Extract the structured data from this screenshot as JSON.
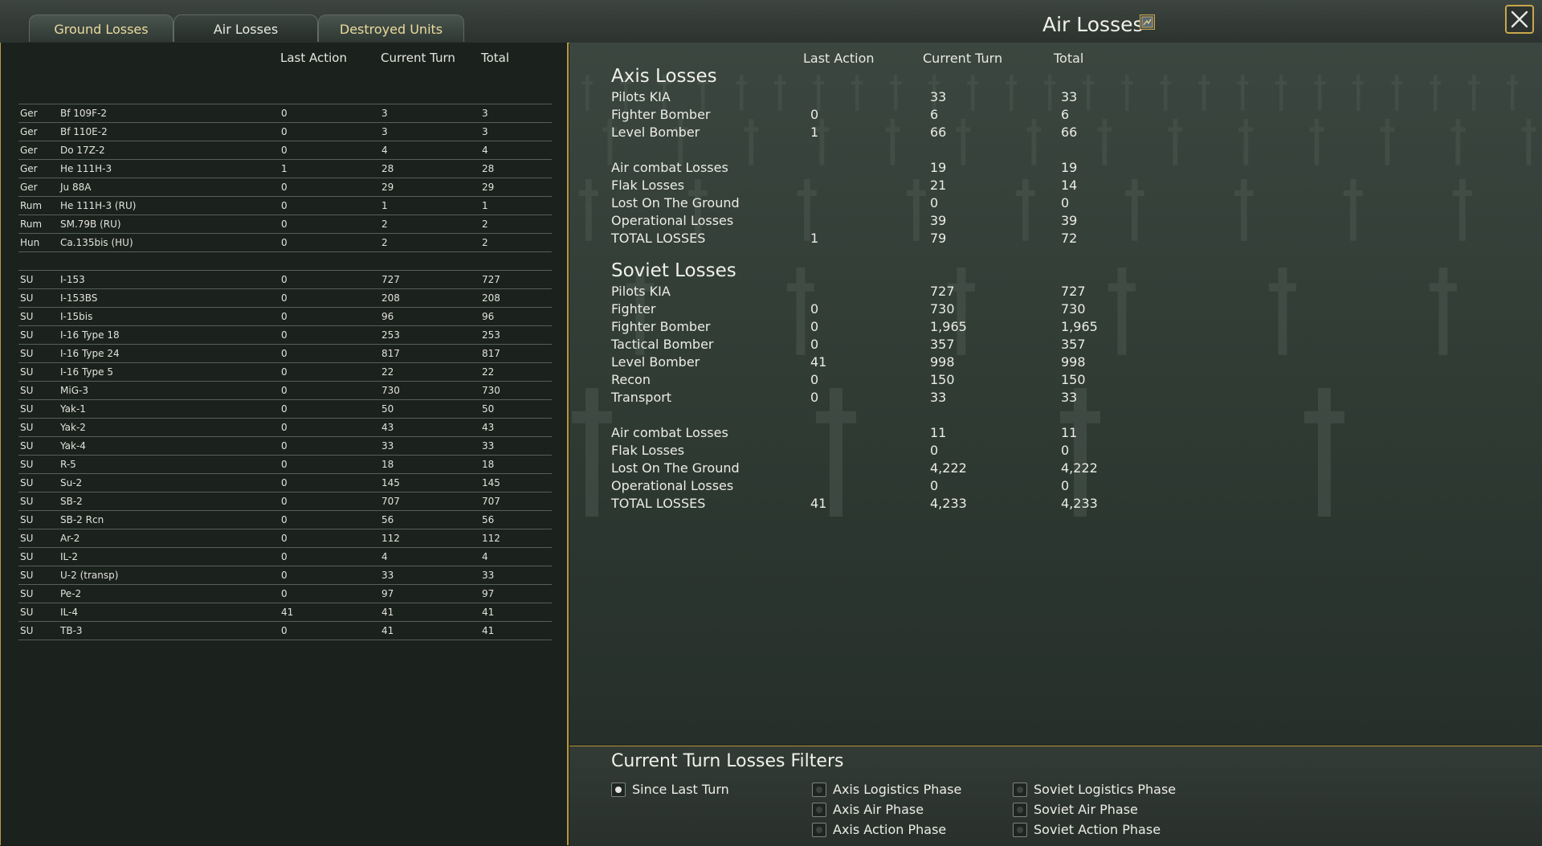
{
  "tabs": {
    "ground": "Ground Losses",
    "air": "Air Losses",
    "destroyed": "Destroyed Units"
  },
  "panel_title": "Air Losses",
  "left": {
    "headers": {
      "last_action": "Last Action",
      "current_turn": "Current Turn",
      "total": "Total"
    },
    "axis_rows": [
      {
        "nat": "Ger",
        "name": "Bf 109F-2",
        "la": "0",
        "ct": "3",
        "tot": "3"
      },
      {
        "nat": "Ger",
        "name": "Bf 110E-2",
        "la": "0",
        "ct": "3",
        "tot": "3"
      },
      {
        "nat": "Ger",
        "name": "Do 17Z-2",
        "la": "0",
        "ct": "4",
        "tot": "4"
      },
      {
        "nat": "Ger",
        "name": "He 111H-3",
        "la": "1",
        "ct": "28",
        "tot": "28"
      },
      {
        "nat": "Ger",
        "name": "Ju 88A",
        "la": "0",
        "ct": "29",
        "tot": "29"
      },
      {
        "nat": "Rum",
        "name": "He 111H-3 (RU)",
        "la": "0",
        "ct": "1",
        "tot": "1"
      },
      {
        "nat": "Rum",
        "name": "SM.79B (RU)",
        "la": "0",
        "ct": "2",
        "tot": "2"
      },
      {
        "nat": "Hun",
        "name": "Ca.135bis (HU)",
        "la": "0",
        "ct": "2",
        "tot": "2"
      }
    ],
    "soviet_rows": [
      {
        "nat": "SU",
        "name": "I-153",
        "la": "0",
        "ct": "727",
        "tot": "727"
      },
      {
        "nat": "SU",
        "name": "I-153BS",
        "la": "0",
        "ct": "208",
        "tot": "208"
      },
      {
        "nat": "SU",
        "name": "I-15bis",
        "la": "0",
        "ct": "96",
        "tot": "96"
      },
      {
        "nat": "SU",
        "name": "I-16 Type 18",
        "la": "0",
        "ct": "253",
        "tot": "253"
      },
      {
        "nat": "SU",
        "name": "I-16 Type 24",
        "la": "0",
        "ct": "817",
        "tot": "817"
      },
      {
        "nat": "SU",
        "name": "I-16 Type 5",
        "la": "0",
        "ct": "22",
        "tot": "22"
      },
      {
        "nat": "SU",
        "name": "MiG-3",
        "la": "0",
        "ct": "730",
        "tot": "730"
      },
      {
        "nat": "SU",
        "name": "Yak-1",
        "la": "0",
        "ct": "50",
        "tot": "50"
      },
      {
        "nat": "SU",
        "name": "Yak-2",
        "la": "0",
        "ct": "43",
        "tot": "43"
      },
      {
        "nat": "SU",
        "name": "Yak-4",
        "la": "0",
        "ct": "33",
        "tot": "33"
      },
      {
        "nat": "SU",
        "name": "R-5",
        "la": "0",
        "ct": "18",
        "tot": "18"
      },
      {
        "nat": "SU",
        "name": "Su-2",
        "la": "0",
        "ct": "145",
        "tot": "145"
      },
      {
        "nat": "SU",
        "name": "SB-2",
        "la": "0",
        "ct": "707",
        "tot": "707"
      },
      {
        "nat": "SU",
        "name": "SB-2 Rcn",
        "la": "0",
        "ct": "56",
        "tot": "56"
      },
      {
        "nat": "SU",
        "name": "Ar-2",
        "la": "0",
        "ct": "112",
        "tot": "112"
      },
      {
        "nat": "SU",
        "name": "IL-2",
        "la": "0",
        "ct": "4",
        "tot": "4"
      },
      {
        "nat": "SU",
        "name": "U-2 (transp)",
        "la": "0",
        "ct": "33",
        "tot": "33"
      },
      {
        "nat": "SU",
        "name": "Pe-2",
        "la": "0",
        "ct": "97",
        "tot": "97"
      },
      {
        "nat": "SU",
        "name": "IL-4",
        "la": "41",
        "ct": "41",
        "tot": "41"
      },
      {
        "nat": "SU",
        "name": "TB-3",
        "la": "0",
        "ct": "41",
        "tot": "41"
      }
    ]
  },
  "right": {
    "headers": {
      "last_action": "Last Action",
      "current_turn": "Current Turn",
      "total": "Total"
    },
    "axis_title": "Axis Losses",
    "axis_rows": [
      {
        "label": "Pilots KIA",
        "la": "",
        "ct": "33",
        "tot": "33"
      },
      {
        "label": "Fighter Bomber",
        "la": "0",
        "ct": "6",
        "tot": "6"
      },
      {
        "label": "Level Bomber",
        "la": "1",
        "ct": "66",
        "tot": "66"
      },
      {
        "label": "",
        "la": "",
        "ct": "",
        "tot": ""
      },
      {
        "label": "Air combat Losses",
        "la": "",
        "ct": "19",
        "tot": "19"
      },
      {
        "label": "Flak Losses",
        "la": "",
        "ct": "21",
        "tot": "14"
      },
      {
        "label": "Lost On The Ground",
        "la": "",
        "ct": "0",
        "tot": "0"
      },
      {
        "label": "Operational Losses",
        "la": "",
        "ct": "39",
        "tot": "39"
      },
      {
        "label": "TOTAL LOSSES",
        "la": "1",
        "ct": "79",
        "tot": "72"
      }
    ],
    "soviet_title": "Soviet Losses",
    "soviet_rows": [
      {
        "label": "Pilots KIA",
        "la": "",
        "ct": "727",
        "tot": "727"
      },
      {
        "label": "Fighter",
        "la": "0",
        "ct": "730",
        "tot": "730"
      },
      {
        "label": "Fighter Bomber",
        "la": "0",
        "ct": "1,965",
        "tot": "1,965"
      },
      {
        "label": "Tactical Bomber",
        "la": "0",
        "ct": "357",
        "tot": "357"
      },
      {
        "label": "Level Bomber",
        "la": "41",
        "ct": "998",
        "tot": "998"
      },
      {
        "label": "Recon",
        "la": "0",
        "ct": "150",
        "tot": "150"
      },
      {
        "label": "Transport",
        "la": "0",
        "ct": "33",
        "tot": "33"
      },
      {
        "label": "",
        "la": "",
        "ct": "",
        "tot": ""
      },
      {
        "label": "Air combat Losses",
        "la": "",
        "ct": "11",
        "tot": "11"
      },
      {
        "label": "Flak Losses",
        "la": "",
        "ct": "0",
        "tot": "0"
      },
      {
        "label": "Lost On The Ground",
        "la": "",
        "ct": "4,222",
        "tot": "4,222"
      },
      {
        "label": "Operational Losses",
        "la": "",
        "ct": "0",
        "tot": "0"
      },
      {
        "label": "TOTAL LOSSES",
        "la": "41",
        "ct": "4,233",
        "tot": "4,233"
      }
    ]
  },
  "filters": {
    "title": "Current Turn Losses Filters",
    "options": [
      {
        "label": "Since Last Turn",
        "selected": true
      },
      {
        "label": "Axis Logistics Phase",
        "selected": false
      },
      {
        "label": "Axis Air Phase",
        "selected": false
      },
      {
        "label": "Axis Action Phase",
        "selected": false
      },
      {
        "label": "Soviet Logistics Phase",
        "selected": false
      },
      {
        "label": "Soviet Air Phase",
        "selected": false
      },
      {
        "label": "Soviet Action Phase",
        "selected": false
      }
    ]
  },
  "colors": {
    "accent_gold": "#b89a3a",
    "tab_text": "#eadb9c"
  }
}
